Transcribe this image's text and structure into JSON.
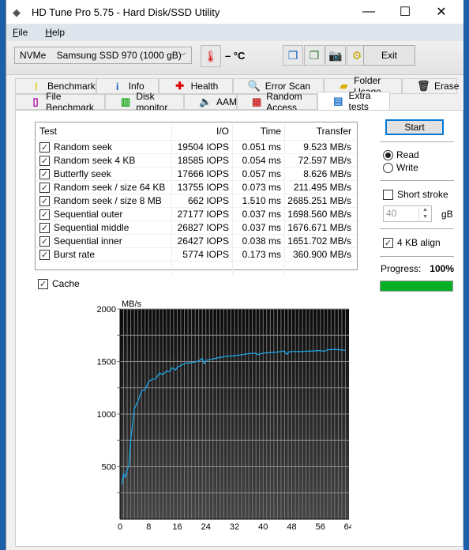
{
  "window": {
    "title": "HD Tune Pro 5.75 - Hard Disk/SSD Utility",
    "minimize": "—",
    "maximize": "☐",
    "close": "✕"
  },
  "menu": [
    {
      "label": "File",
      "u": "F",
      "rest": "ile"
    },
    {
      "label": "Help",
      "u": "H",
      "rest": "elp"
    }
  ],
  "toolbar": {
    "drive": "NVMe    Samsung SSD 970 (1000 gB)",
    "temperature": "– °C",
    "exit": "Exit"
  },
  "tabs_row1": [
    {
      "label": "Benchmark",
      "icon": "exclamation-icon"
    },
    {
      "label": "Info",
      "icon": "info-icon"
    },
    {
      "label": "Health",
      "icon": "health-cross-icon"
    },
    {
      "label": "Error Scan",
      "icon": "magnifier-icon"
    },
    {
      "label": "Folder Usage",
      "icon": "folder-icon"
    },
    {
      "label": "Erase",
      "icon": "trash-icon"
    }
  ],
  "tabs_row2": [
    {
      "label": "File Benchmark",
      "icon": "file-benchmark-icon"
    },
    {
      "label": "Disk monitor",
      "icon": "disk-monitor-icon"
    },
    {
      "label": "AAM",
      "icon": "speaker-icon"
    },
    {
      "label": "Random Access",
      "icon": "random-access-icon"
    },
    {
      "label": "Extra tests",
      "icon": "extra-tests-icon",
      "active": true
    }
  ],
  "table": {
    "headers": [
      "Test",
      "I/O",
      "Time",
      "Transfer"
    ],
    "rows": [
      {
        "test": "Random seek",
        "io": "19504 IOPS",
        "time": "0.051 ms",
        "transfer": "9.523 MB/s",
        "checked": true
      },
      {
        "test": "Random seek 4 KB",
        "io": "18585 IOPS",
        "time": "0.054 ms",
        "transfer": "72.597 MB/s",
        "checked": true
      },
      {
        "test": "Butterfly seek",
        "io": "17666 IOPS",
        "time": "0.057 ms",
        "transfer": "8.626 MB/s",
        "checked": true
      },
      {
        "test": "Random seek / size 64 KB",
        "io": "13755 IOPS",
        "time": "0.073 ms",
        "transfer": "211.495 MB/s",
        "checked": true
      },
      {
        "test": "Random seek / size 8 MB",
        "io": "662 IOPS",
        "time": "1.510 ms",
        "transfer": "2685.251 MB/s",
        "checked": true
      },
      {
        "test": "Sequential outer",
        "io": "27177 IOPS",
        "time": "0.037 ms",
        "transfer": "1698.560 MB/s",
        "checked": true
      },
      {
        "test": "Sequential middle",
        "io": "26827 IOPS",
        "time": "0.037 ms",
        "transfer": "1676.671 MB/s",
        "checked": true
      },
      {
        "test": "Sequential inner",
        "io": "26427 IOPS",
        "time": "0.038 ms",
        "transfer": "1651.702 MB/s",
        "checked": true
      },
      {
        "test": "Burst rate",
        "io": "5774 IOPS",
        "time": "0.173 ms",
        "transfer": "360.900 MB/s",
        "checked": true
      }
    ]
  },
  "side": {
    "start": "Start",
    "read": "Read",
    "write": "Write",
    "mode": "read",
    "short_stroke": "Short stroke",
    "short_stroke_checked": false,
    "stroke_value": "40",
    "stroke_unit": "gB",
    "align": "4 KB align",
    "align_checked": true,
    "progress_label": "Progress:",
    "progress_text": "100%",
    "progress": 100,
    "progress_color": "#06b025"
  },
  "cache": {
    "label": "Cache",
    "checked": true
  },
  "chart_data": {
    "type": "line",
    "ylabel": "MB/s",
    "xunit": "MB",
    "xlim": [
      0,
      64
    ],
    "ylim": [
      0,
      2000
    ],
    "xticks": [
      "0",
      "8",
      "16",
      "24",
      "32",
      "40",
      "48",
      "56",
      "64MB"
    ],
    "yticks": [
      "500",
      "1000",
      "1500",
      "2000"
    ],
    "grid": true,
    "line_color": "#1aa6e8",
    "points": [
      [
        0.5,
        330
      ],
      [
        1,
        430
      ],
      [
        1.5,
        400
      ],
      [
        2,
        470
      ],
      [
        2.5,
        510
      ],
      [
        3,
        760
      ],
      [
        3.5,
        900
      ],
      [
        4,
        1050
      ],
      [
        5,
        1120
      ],
      [
        6,
        1220
      ],
      [
        7,
        1230
      ],
      [
        8,
        1310
      ],
      [
        9,
        1330
      ],
      [
        10,
        1335
      ],
      [
        11,
        1390
      ],
      [
        12,
        1375
      ],
      [
        13,
        1410
      ],
      [
        14,
        1405
      ],
      [
        14.5,
        1440
      ],
      [
        15.5,
        1420
      ],
      [
        16,
        1445
      ],
      [
        18,
        1480
      ],
      [
        20,
        1490
      ],
      [
        22,
        1505
      ],
      [
        23,
        1530
      ],
      [
        23.5,
        1480
      ],
      [
        24,
        1510
      ],
      [
        26,
        1525
      ],
      [
        28,
        1540
      ],
      [
        30,
        1550
      ],
      [
        32,
        1555
      ],
      [
        34,
        1565
      ],
      [
        36,
        1575
      ],
      [
        38,
        1580
      ],
      [
        38.5,
        1565
      ],
      [
        40,
        1580
      ],
      [
        42,
        1585
      ],
      [
        44,
        1590
      ],
      [
        46,
        1600
      ],
      [
        46.5,
        1570
      ],
      [
        47.5,
        1595
      ],
      [
        50,
        1595
      ],
      [
        54,
        1600
      ],
      [
        56,
        1605
      ],
      [
        57,
        1595
      ],
      [
        58,
        1612
      ],
      [
        60,
        1615
      ],
      [
        62,
        1610
      ],
      [
        63,
        1605
      ]
    ]
  }
}
